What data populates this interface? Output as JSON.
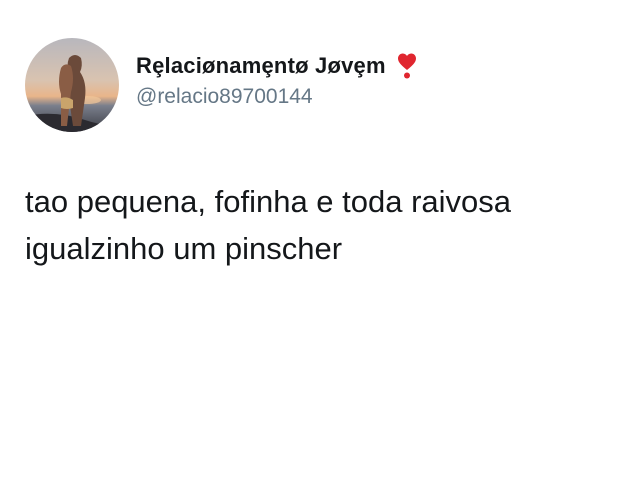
{
  "author": {
    "display_name": "Rȩlaciønamȩntø Jøvȩm",
    "name_emoji": "heart-exclamation-icon",
    "handle": "@relacio89700144",
    "avatar": "profile-photo-couple-at-sunset"
  },
  "tweet": {
    "lines": [
      "tao pequena, fofinha e toda raivosa",
      "igualzinho um pinscher"
    ]
  },
  "colors": {
    "text_primary": "#14171a",
    "text_secondary": "#657786",
    "emoji_red": "#e0262f",
    "background": "#ffffff"
  }
}
